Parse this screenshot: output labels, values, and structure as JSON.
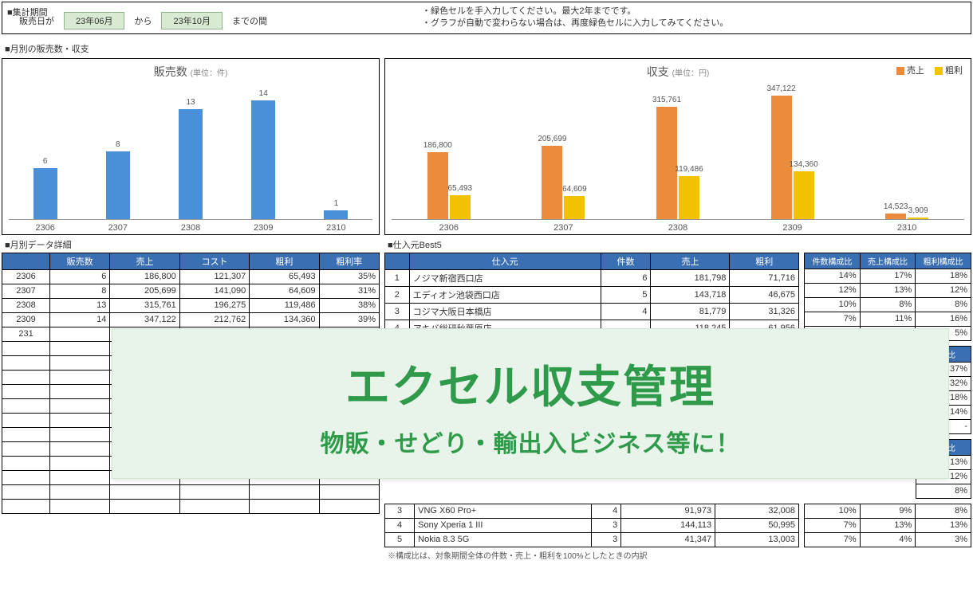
{
  "period": {
    "section": "■集計期間",
    "label1": "販売日が",
    "from": "23年06月",
    "between": "から",
    "to": "23年10月",
    "after": "までの間",
    "note1": "・緑色セルを手入力してください。最大2年までです。",
    "note2": "・グラフが自動で変わらない場合は、再度緑色セルに入力してみてください。"
  },
  "charts_section": "■月別の販売数・収支",
  "chart_data": [
    {
      "type": "bar",
      "title": "販売数",
      "unit": "(単位：件)",
      "categories": [
        "2306",
        "2307",
        "2308",
        "2309",
        "2310"
      ],
      "values": [
        6,
        8,
        13,
        14,
        1
      ],
      "ylim": [
        0,
        16
      ],
      "color": "#4a90d9"
    },
    {
      "type": "bar",
      "title": "収支",
      "unit": "(単位：円)",
      "categories": [
        "2306",
        "2307",
        "2308",
        "2309",
        "2310"
      ],
      "series": [
        {
          "name": "売上",
          "color": "#ed8b3c",
          "values": [
            186800,
            205699,
            315761,
            347122,
            14523
          ]
        },
        {
          "name": "粗利",
          "color": "#f2c200",
          "values": [
            65493,
            64609,
            119486,
            134360,
            3909
          ]
        }
      ],
      "ylim": [
        0,
        380000
      ]
    }
  ],
  "legend": {
    "sales": "売上",
    "profit": "粗利"
  },
  "monthly_detail": {
    "section": "■月別データ詳細",
    "headers": [
      "",
      "販売数",
      "売上",
      "コスト",
      "粗利",
      "粗利率"
    ],
    "rows": [
      [
        "2306",
        "6",
        "186,800",
        "121,307",
        "65,493",
        "35%"
      ],
      [
        "2307",
        "8",
        "205,699",
        "141,090",
        "64,609",
        "31%"
      ],
      [
        "2308",
        "13",
        "315,761",
        "196,275",
        "119,486",
        "38%"
      ],
      [
        "2309",
        "14",
        "347,122",
        "212,762",
        "134,360",
        "39%"
      ],
      [
        "231",
        "",
        "",
        "",
        "",
        ""
      ]
    ],
    "blank_rows": 12
  },
  "supplier": {
    "section": "■仕入元Best5",
    "headers": [
      "",
      "仕入元",
      "件数",
      "売上",
      "粗利"
    ],
    "rows": [
      [
        "1",
        "ノジマ新宿西口店",
        "6",
        "181,798",
        "71,716"
      ],
      [
        "2",
        "エディオン池袋西口店",
        "5",
        "143,718",
        "46,675"
      ],
      [
        "3",
        "コジマ大阪日本橋店",
        "4",
        "81,779",
        "31,326"
      ],
      [
        "4",
        "アキバ総研秋葉原店",
        "",
        "118,245",
        "61,956"
      ]
    ],
    "ratio_headers": [
      "件数構成比",
      "売上構成比",
      "粗利構成比"
    ],
    "ratio_rows": [
      [
        "14%",
        "17%",
        "18%"
      ],
      [
        "12%",
        "13%",
        "12%"
      ],
      [
        "10%",
        "8%",
        "8%"
      ],
      [
        "7%",
        "11%",
        "16%"
      ],
      [
        "",
        "",
        "5%"
      ]
    ],
    "ratio2_header": "構成比",
    "ratio2_rows": [
      "37%",
      "32%",
      "18%",
      "14%",
      "-"
    ],
    "ratio3_header": "構成比",
    "ratio3_rows": [
      "13%",
      "12%",
      "8%"
    ]
  },
  "product": {
    "rows": [
      [
        "3",
        "VNG X60 Pro+",
        "4",
        "91,973",
        "32,008"
      ],
      [
        "4",
        "Sony Xperia 1 III",
        "3",
        "144,113",
        "50,995"
      ],
      [
        "5",
        "Nokia 8.3 5G",
        "3",
        "41,347",
        "13,003"
      ]
    ],
    "ratio_rows": [
      [
        "10%",
        "9%",
        "8%"
      ],
      [
        "7%",
        "13%",
        "13%"
      ],
      [
        "7%",
        "4%",
        "3%"
      ]
    ],
    "footnote": "※構成比は、対象期間全体の件数・売上・粗利を100%としたときの内訳"
  },
  "overlay": {
    "title": "エクセル収支管理",
    "subtitle": "物販・せどり・輸出入ビジネス等に！"
  }
}
